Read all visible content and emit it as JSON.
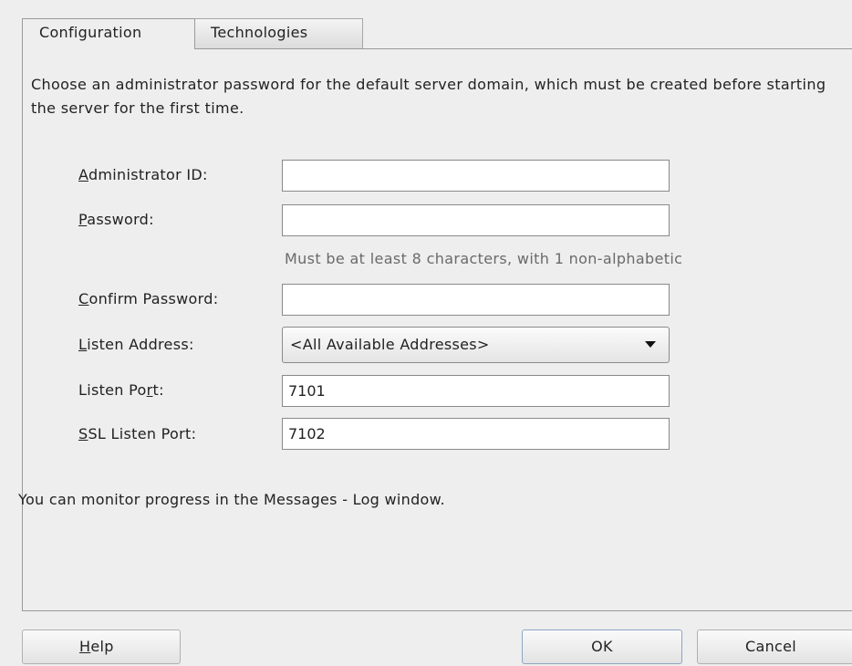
{
  "tabs": [
    {
      "label": "Configuration",
      "active": true
    },
    {
      "label": "Technologies",
      "active": false
    }
  ],
  "description": "Choose an administrator password for the default server domain, which must be created before starting the server for the first time.",
  "form": {
    "admin_id": {
      "mnemonic": "A",
      "label_rest": "dministrator ID:",
      "value": ""
    },
    "password": {
      "mnemonic": "P",
      "label_rest": "assword:",
      "value": ""
    },
    "password_hint": "Must be at least 8 characters, with 1 non-alphabetic",
    "confirm_password": {
      "mnemonic": "C",
      "label_rest": "onfirm Password:",
      "value": ""
    },
    "listen_address": {
      "mnemonic": "L",
      "label_rest": "isten Address:",
      "value": "<All Available Addresses>"
    },
    "listen_port": {
      "label_before": "Listen Po",
      "mnemonic": "r",
      "label_after": "t:",
      "value": "7101"
    },
    "ssl_listen_port": {
      "mnemonic": "S",
      "label_rest": "SL Listen Port:",
      "value": "7102"
    }
  },
  "note": "You can monitor progress in the Messages - Log window.",
  "buttons": {
    "help": {
      "mnemonic": "H",
      "label_rest": "elp"
    },
    "ok": "OK",
    "cancel": "Cancel"
  },
  "icons": {
    "dropdown": "chevron-down-icon"
  },
  "colors": {
    "background": "#eeeeee",
    "hint_text": "#6a6a6a",
    "ok_border": "#8ca6c2"
  }
}
